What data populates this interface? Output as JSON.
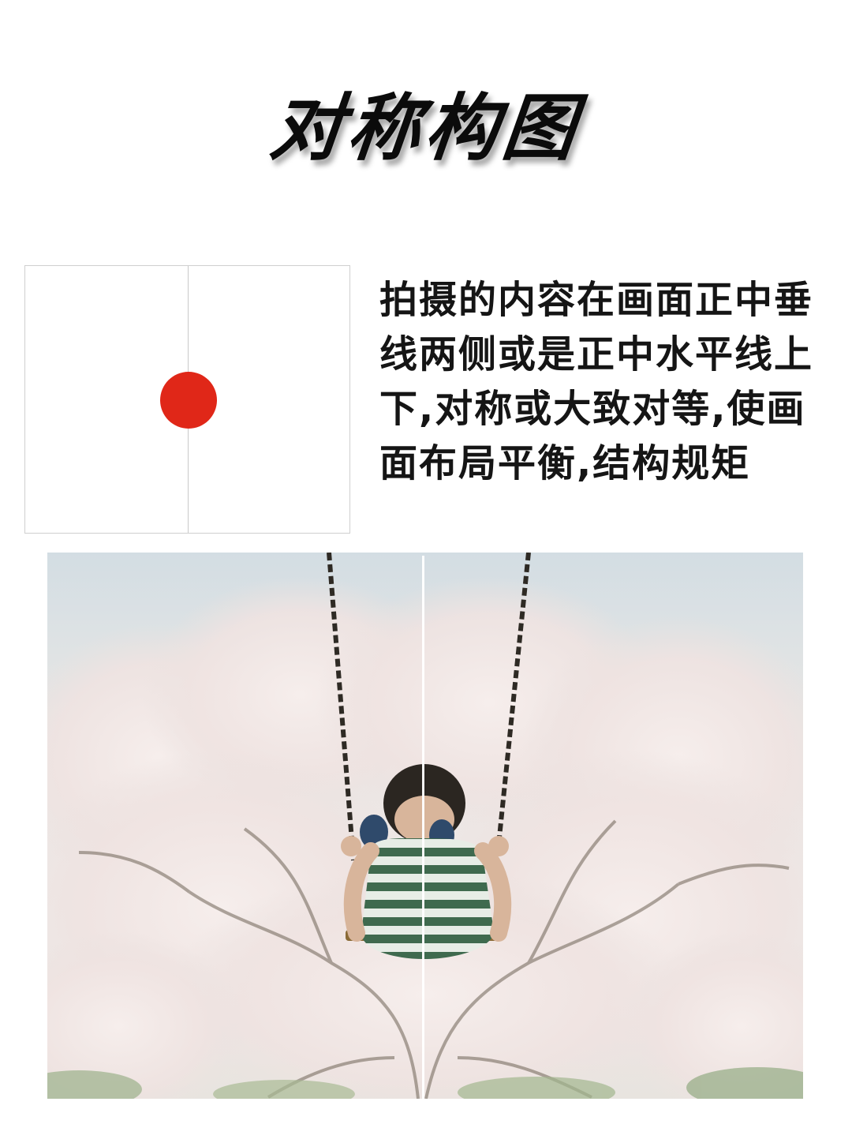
{
  "title": "对称构图",
  "description": "拍摄的内容在画面正中垂线两侧或是正中水平线上下,对称或大致对等,使画面布局平衡,结构规矩",
  "diagram": {
    "dot_color": "#e02718"
  },
  "colors": {
    "title": "#0b0b0b",
    "text": "#151515",
    "accent": "#e02718"
  }
}
